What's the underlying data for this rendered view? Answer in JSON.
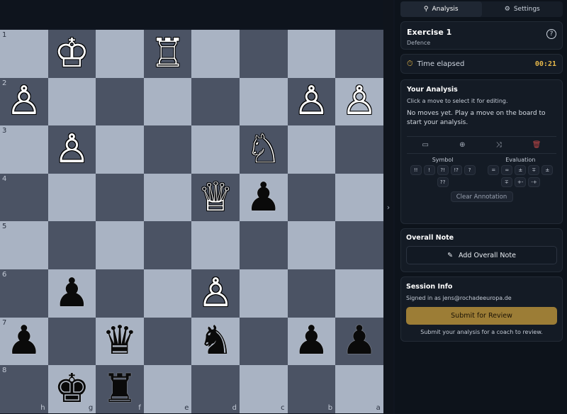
{
  "tabs": {
    "analysis": "Analysis",
    "settings": "Settings"
  },
  "exercise": {
    "title": "Exercise 1",
    "subtitle": "Defence",
    "help": "?"
  },
  "timer": {
    "label": "Time elapsed",
    "value": "00:21"
  },
  "analysis": {
    "heading": "Your Analysis",
    "hint": "Click a move to select it for editing.",
    "empty": "No moves yet. Play a move on the board to start your analysis.",
    "symbol_title": "Symbol",
    "evaluation_title": "Evaluation",
    "symbols": [
      "!!",
      "!",
      "?!",
      "!?",
      "?",
      "??"
    ],
    "evaluations": [
      "=",
      "∞",
      "±",
      "∓",
      "±",
      "∓",
      "+-",
      "-+"
    ],
    "clear_label": "Clear Annotation"
  },
  "overall": {
    "heading": "Overall Note",
    "button": "Add Overall Note"
  },
  "session": {
    "heading": "Session Info",
    "signed_in": "Signed in as jens@rochadeeuropa.de",
    "submit": "Submit for Review",
    "hint": "Submit your analysis for a coach to review."
  },
  "board": {
    "ranks": [
      "1",
      "2",
      "3",
      "4",
      "5",
      "6",
      "7",
      "8"
    ],
    "files": [
      "h",
      "g",
      "f",
      "e",
      "d",
      "c",
      "b",
      "a"
    ],
    "pieces": [
      [
        "",
        "♔w",
        "",
        "♖w",
        "",
        "",
        "",
        ""
      ],
      [
        "♙w",
        "",
        "",
        "",
        "",
        "",
        "♙w",
        "♙w"
      ],
      [
        "",
        "♙w",
        "",
        "",
        "",
        "♘w",
        "",
        ""
      ],
      [
        "",
        "",
        "",
        "",
        "♕w",
        "♟b",
        "",
        ""
      ],
      [
        "",
        "",
        "",
        "",
        "",
        "",
        "",
        ""
      ],
      [
        "",
        "♟b",
        "",
        "",
        "♙w",
        "",
        "",
        ""
      ],
      [
        "♟b",
        "",
        "♛b",
        "",
        "♞b",
        "",
        "♟b",
        "♟b"
      ],
      [
        "",
        "♚b",
        "♜b",
        "",
        "",
        "",
        "",
        ""
      ]
    ]
  }
}
